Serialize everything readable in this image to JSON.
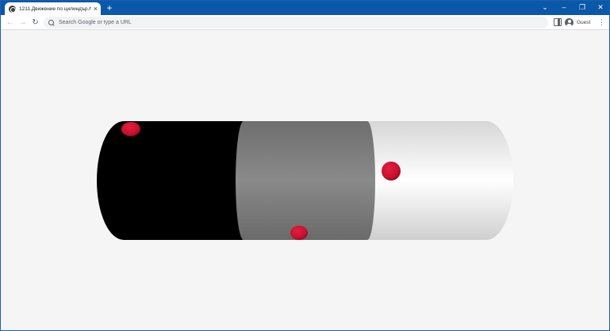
{
  "browser": {
    "tab": {
      "title": "1211.Движение по цилиндър.h",
      "close_glyph": "×",
      "favicon": "globe-icon"
    },
    "new_tab_glyph": "+",
    "window_controls": {
      "dropdown": "⌄",
      "minimize": "–",
      "maximize": "❐",
      "close": "✕"
    },
    "toolbar": {
      "back_glyph": "←",
      "forward_glyph": "→",
      "reload_glyph": "↻",
      "omnibox_placeholder": "Search Google or type a URL",
      "profile_name": "Guest",
      "menu_glyph": "⋮"
    }
  },
  "scene": {
    "cylinder_segments": [
      {
        "name": "black-segment",
        "color": "#000000"
      },
      {
        "name": "gray-segment",
        "color": "#808080"
      },
      {
        "name": "white-segment",
        "color": "#ffffff"
      }
    ],
    "ball_color": "#c8102e",
    "ball_count": 3
  }
}
